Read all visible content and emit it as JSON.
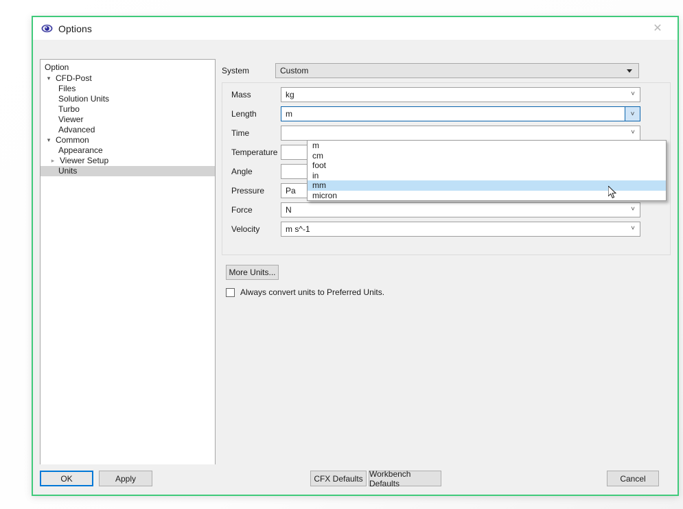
{
  "window": {
    "title": "Options",
    "icon": "eye-icon",
    "close_label": "✕",
    "border_color": "#3fca7a"
  },
  "tree": {
    "header": "Option",
    "items": [
      {
        "label": "CFD-Post",
        "depth": 0,
        "arrow": "down",
        "selected": false
      },
      {
        "label": "Files",
        "depth": 1,
        "arrow": "none",
        "selected": false
      },
      {
        "label": "Solution Units",
        "depth": 1,
        "arrow": "none",
        "selected": false
      },
      {
        "label": "Turbo",
        "depth": 1,
        "arrow": "none",
        "selected": false
      },
      {
        "label": "Viewer",
        "depth": 1,
        "arrow": "none",
        "selected": false
      },
      {
        "label": "Advanced",
        "depth": 1,
        "arrow": "none",
        "selected": false
      },
      {
        "label": "Common",
        "depth": 0,
        "arrow": "down",
        "selected": false
      },
      {
        "label": "Appearance",
        "depth": 1,
        "arrow": "none",
        "selected": false
      },
      {
        "label": "Viewer Setup",
        "depth": 1,
        "arrow": "right",
        "selected": false
      },
      {
        "label": "Units",
        "depth": 1,
        "arrow": "none",
        "selected": true
      }
    ]
  },
  "system": {
    "label": "System",
    "value": "Custom",
    "disabled": true
  },
  "units": {
    "fields": [
      {
        "label": "Mass",
        "value": "kg",
        "focused": false
      },
      {
        "label": "Length",
        "value": "m",
        "focused": true
      },
      {
        "label": "Time",
        "value": "",
        "focused": false
      },
      {
        "label": "Temperature",
        "value": "",
        "focused": false
      },
      {
        "label": "Angle",
        "value": "",
        "focused": false
      },
      {
        "label": "Pressure",
        "value": "Pa",
        "focused": false
      },
      {
        "label": "Force",
        "value": "N",
        "focused": false
      },
      {
        "label": "Velocity",
        "value": "m s^-1",
        "focused": false
      }
    ]
  },
  "dropdown": {
    "open_for": "Length",
    "items": [
      "m",
      "cm",
      "foot",
      "in",
      "mm",
      "micron"
    ],
    "highlighted_index": 4,
    "highlight_color": "#bfe0f7"
  },
  "more_units": {
    "label": "More Units..."
  },
  "checkbox": {
    "label": "Always convert units to Preferred Units.",
    "checked": false
  },
  "buttons": {
    "ok": "OK",
    "apply": "Apply",
    "cfx_defaults": "CFX Defaults",
    "workbench_defaults": "Workbench Defaults",
    "cancel": "Cancel",
    "default_border_color": "#0078d7"
  }
}
